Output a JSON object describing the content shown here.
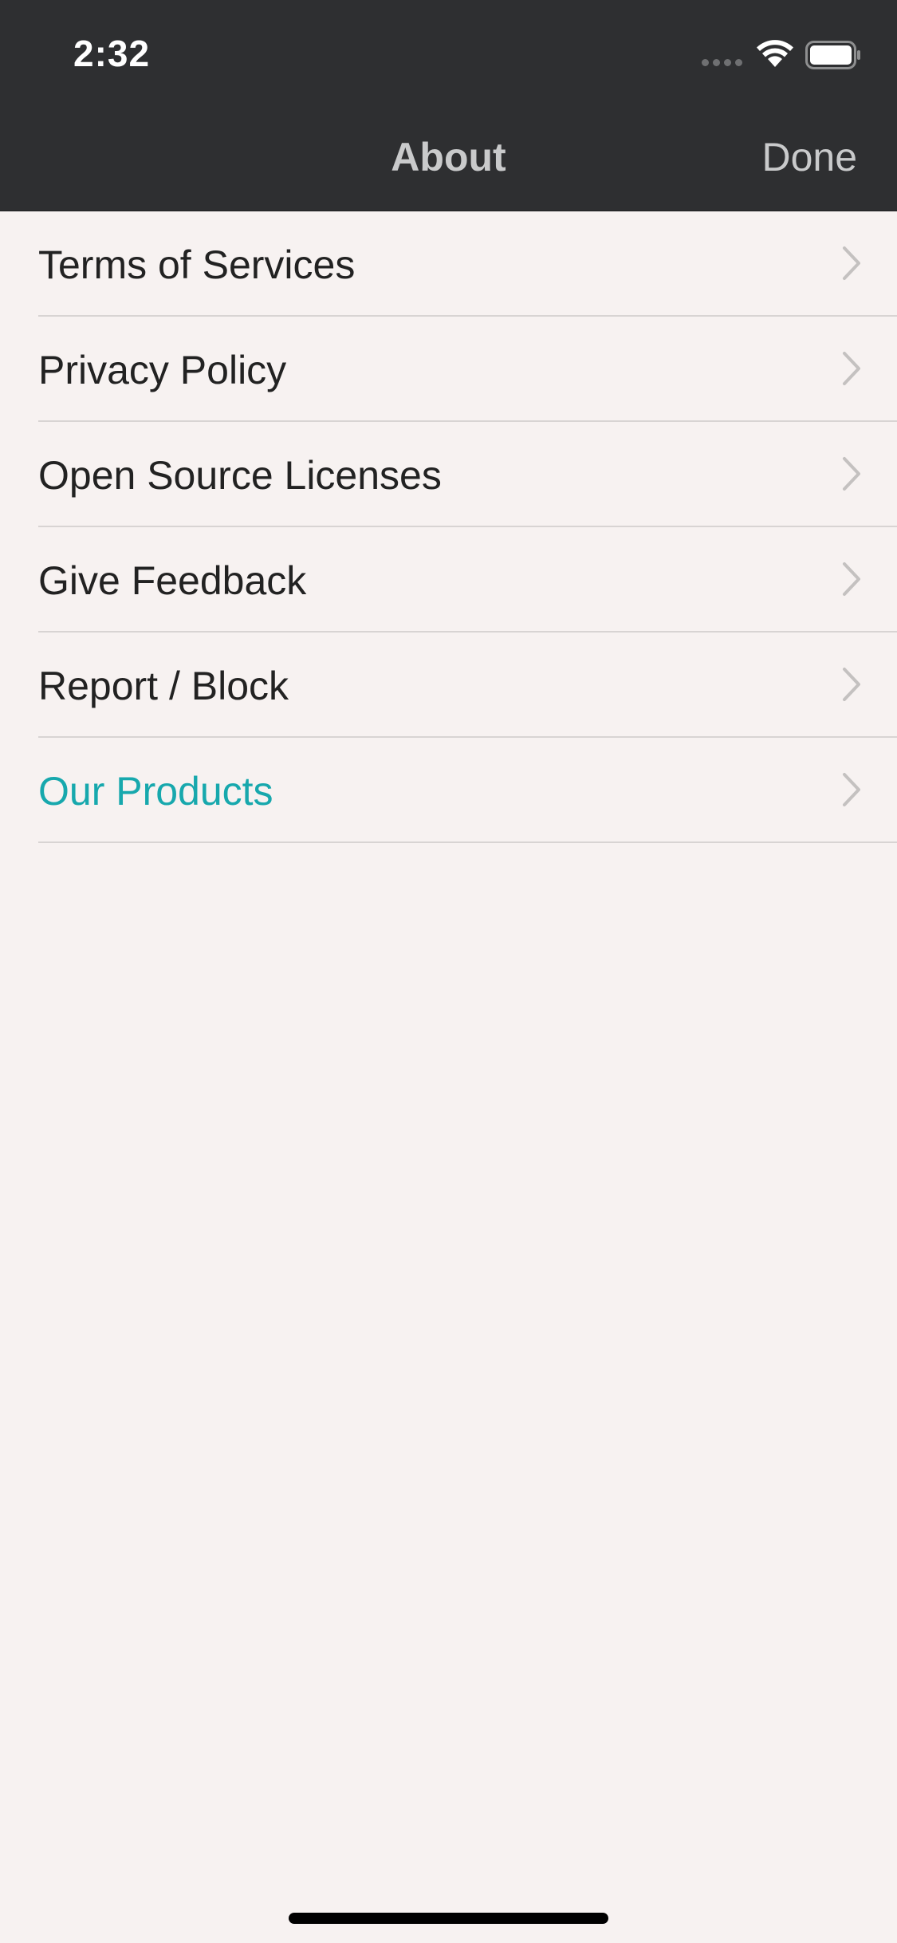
{
  "status_bar": {
    "time": "2:32",
    "icons": [
      "cellular-signal-icon",
      "wifi-icon",
      "battery-icon"
    ]
  },
  "nav": {
    "title": "About",
    "done_label": "Done"
  },
  "colors": {
    "header_bg": "#2e2f31",
    "page_bg": "#f7f2f1",
    "accent": "#17a8ad",
    "nav_text": "#c9cacb",
    "row_text": "#222222",
    "chevron": "#c4c1c0"
  },
  "menu": {
    "items": [
      {
        "label": "Terms of Services",
        "icon": "chevron-right-icon"
      },
      {
        "label": "Privacy Policy",
        "icon": "chevron-right-icon"
      },
      {
        "label": "Open Source Licenses",
        "icon": "chevron-right-icon"
      },
      {
        "label": "Give Feedback",
        "icon": "chevron-right-icon"
      },
      {
        "label": "Report / Block",
        "icon": "chevron-right-icon"
      },
      {
        "label": "Our Products",
        "icon": "chevron-right-icon",
        "accent": true
      }
    ]
  }
}
